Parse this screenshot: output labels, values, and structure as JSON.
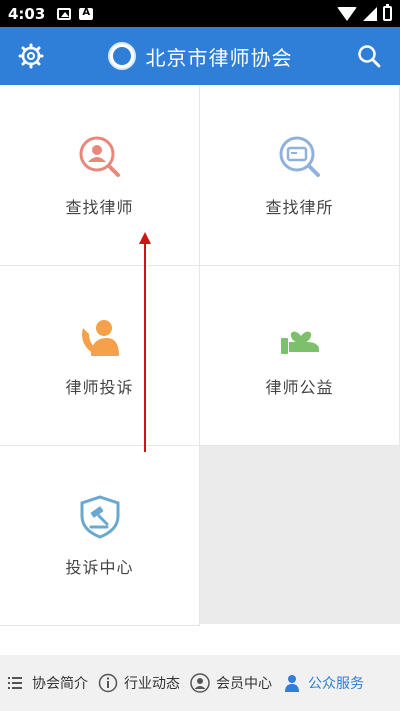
{
  "status_bar": {
    "time": "4:03"
  },
  "header": {
    "title": "北京市律师协会"
  },
  "grid": {
    "items": [
      {
        "label": "查找律师",
        "icon": "lawyer-search-icon",
        "color": "#e9877a"
      },
      {
        "label": "查找律所",
        "icon": "firm-search-icon",
        "color": "#8fb1db"
      },
      {
        "label": "律师投诉",
        "icon": "phone-user-icon",
        "color": "#f5a04a"
      },
      {
        "label": "律师公益",
        "icon": "hand-heart-icon",
        "color": "#7dc06b"
      },
      {
        "label": "投诉中心",
        "icon": "gavel-shield-icon",
        "color": "#6aa8cf"
      }
    ]
  },
  "bottom_nav": {
    "items": [
      {
        "label": "协会简介",
        "icon": "list-icon"
      },
      {
        "label": "行业动态",
        "icon": "info-icon"
      },
      {
        "label": "会员中心",
        "icon": "member-icon"
      },
      {
        "label": "公众服务",
        "icon": "public-service-icon",
        "active": true
      }
    ]
  },
  "colors": {
    "header_bg": "#2f7ed8",
    "active_nav": "#2f7ed8",
    "annotation_arrow": "#d01414"
  }
}
